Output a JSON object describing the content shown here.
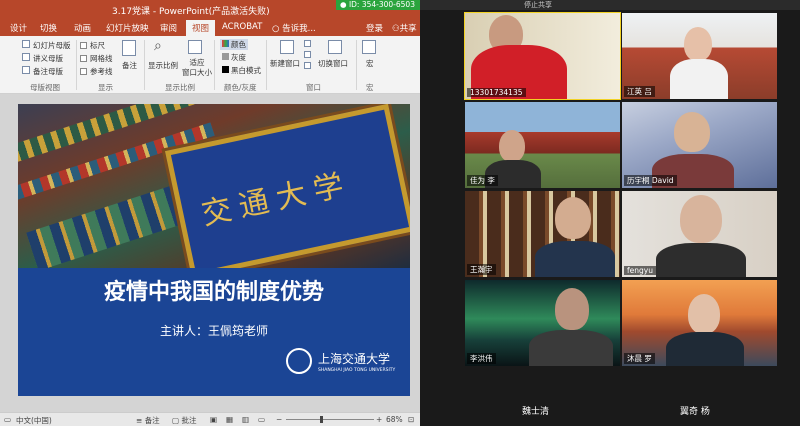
{
  "ppt": {
    "title": "3.17党课 - PowerPoint(产品激活失败)",
    "window_buttons": [
      "—",
      "❐",
      "✕"
    ],
    "menu": [
      "设计",
      "切换",
      "动画",
      "幻灯片放映",
      "审阅",
      "视图",
      "ACROBAT",
      "告诉我..."
    ],
    "active_menu": "视图",
    "user": {
      "login": "登录",
      "share": "共享"
    },
    "ribbon": {
      "master_views": [
        "幻灯片母版",
        "讲义母版",
        "备注母版"
      ],
      "show_checks": [
        "标尺",
        "网格线",
        "参考线"
      ],
      "notes": "备注",
      "zoom": "显示比例",
      "fit": "适应\n窗口大小",
      "color_options": [
        "颜色",
        "灰度",
        "黑白模式"
      ],
      "new_window": "新建窗口",
      "switch_window": "切换窗口",
      "macro": "宏",
      "groups": [
        "母版视图",
        "显示",
        "显示比例",
        "颜色/灰度",
        "窗口",
        "宏"
      ]
    },
    "slide": {
      "title": "疫情中我国的制度优势",
      "subtitle": "主讲人：王佩筠老师",
      "plaque_text": "交通大学",
      "university_cn": "上海交通大学",
      "university_en": "SHANGHAI JIAO TONG UNIVERSITY"
    },
    "status": {
      "language": "中文(中国)",
      "notes": "备注",
      "comments": "批注",
      "zoom": "68%"
    }
  },
  "meeting": {
    "id_label": "ID: 354-300-6503",
    "top_label": "停止共享",
    "participants": [
      {
        "name": "13301734135",
        "active": true
      },
      {
        "name": "江英 吕"
      },
      {
        "name": "佳为 李"
      },
      {
        "name": "历宇桐 David"
      },
      {
        "name": "王瀚宇"
      },
      {
        "name": "fengyu"
      },
      {
        "name": "李洪伟"
      },
      {
        "name": "沐晨 罗"
      }
    ],
    "bottom_names": [
      "魏士清",
      "翼奇 杨"
    ]
  },
  "colors": {
    "ppt_accent": "#b7472a",
    "slide_blue": "#1b4595",
    "meeting_id_green": "#2aa43d",
    "active_speaker": "#f2d224"
  }
}
